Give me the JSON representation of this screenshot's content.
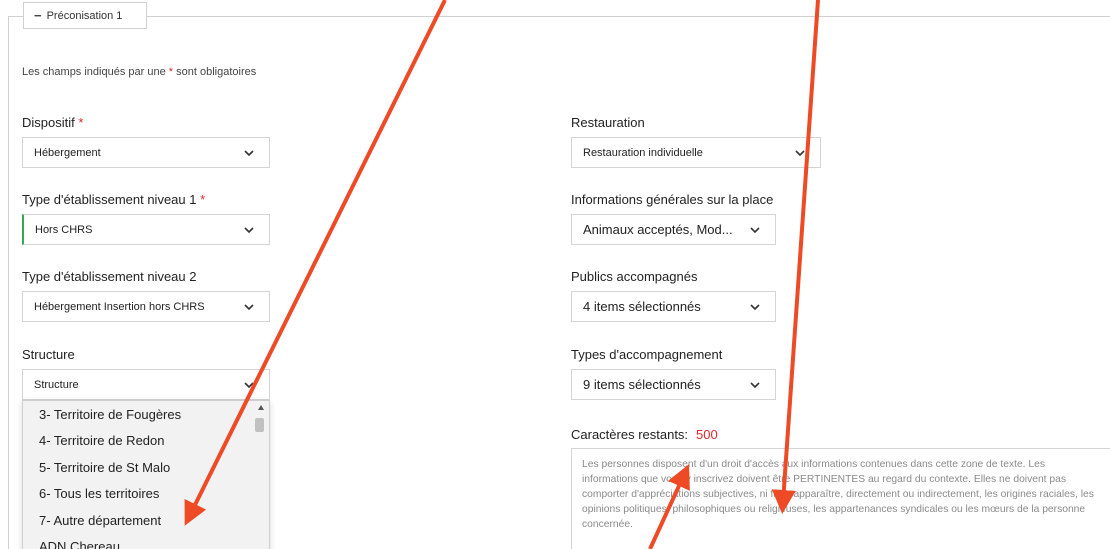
{
  "section": {
    "legend_symbol": "−",
    "legend_label": "Préconisation 1",
    "required_note_before": "Les champs indiqués par une",
    "required_star": "*",
    "required_note_after": "sont obligatoires"
  },
  "left": {
    "dispositif": {
      "label": "Dispositif",
      "value": "Hébergement"
    },
    "type_niveau1": {
      "label": "Type d'établissement niveau 1",
      "value": "Hors CHRS"
    },
    "type_niveau2": {
      "label": "Type d'établissement niveau 2",
      "value": "Hébergement Insertion hors CHRS"
    },
    "structure": {
      "label": "Structure",
      "value": "Structure",
      "options": [
        "3- Territoire de Fougères",
        "4- Territoire de Redon",
        "5- Territoire de St Malo",
        "6- Tous les territoires",
        "7- Autre département",
        "ADN Chereau"
      ]
    }
  },
  "right": {
    "restauration": {
      "label": "Restauration",
      "value": "Restauration individuelle"
    },
    "infos_place": {
      "label": "Informations générales sur la place",
      "value": "Animaux acceptés, Mod..."
    },
    "publics": {
      "label": "Publics accompagnés",
      "value": "4 items sélectionnés"
    },
    "types_accompagnement": {
      "label": "Types d'accompagnement",
      "value": "9 items sélectionnés"
    },
    "chars_remaining_label": "Caractères restants:",
    "chars_remaining_value": "500",
    "textarea_placeholder": "Les personnes disposent d'un droit d'accès aux informations contenues dans cette zone de texte. Les informations que vous y inscrivez doivent être PERTINENTES au regard du contexte. Elles ne doivent pas comporter d'appréciations subjectives, ni faire apparaître, directement ou indirectement, les origines raciales, les opinions politiques, philosophiques ou religieuses, les appartenances syndicales ou les mœurs de la personne concernée."
  },
  "annotation_color": "#ee4a26",
  "required_color": "#e0262c",
  "icons": [
    "chevron-down-icon",
    "scroll-up-icon"
  ]
}
